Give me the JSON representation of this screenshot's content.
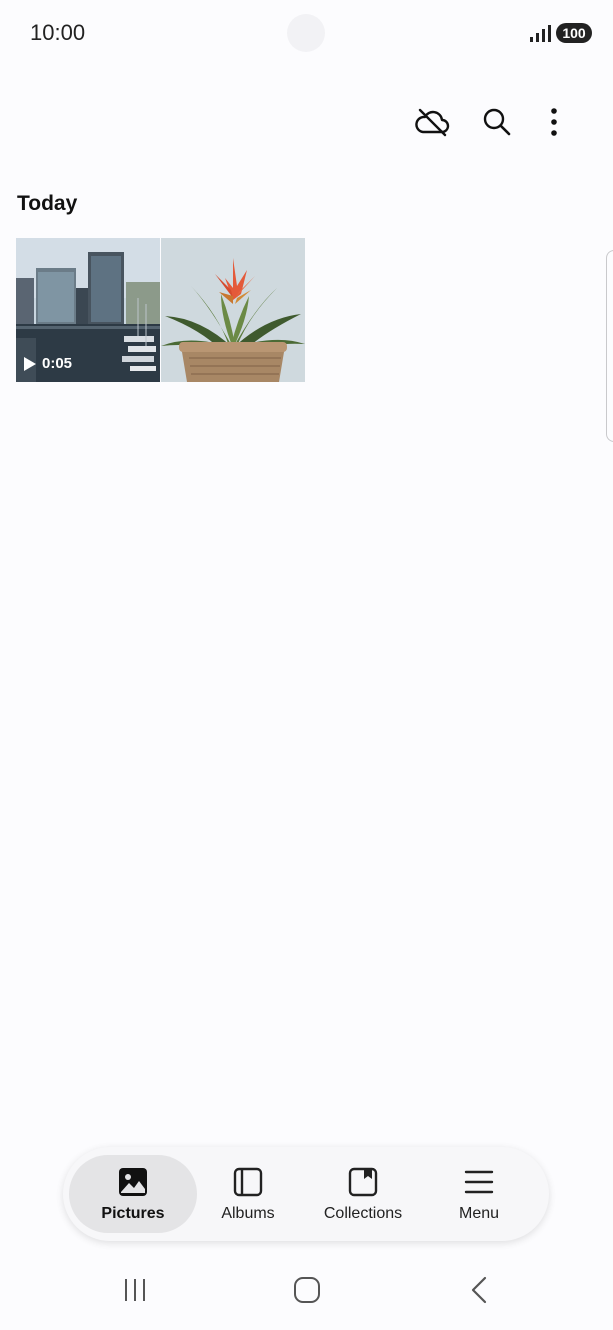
{
  "status_bar": {
    "time": "10:00",
    "battery": "100"
  },
  "toolbar": {
    "icons": [
      "cloud-off-icon",
      "search-icon",
      "more-vertical-icon"
    ]
  },
  "gallery": {
    "section_title": "Today",
    "items": [
      {
        "type": "video",
        "duration": "0:05",
        "subject": "harbor buildings"
      },
      {
        "type": "image",
        "subject": "potted bromeliad"
      }
    ]
  },
  "bottom_nav": {
    "items": [
      {
        "label": "Pictures",
        "icon": "pictures-icon",
        "active": true
      },
      {
        "label": "Albums",
        "icon": "albums-icon",
        "active": false
      },
      {
        "label": "Collections",
        "icon": "collections-icon",
        "active": false
      },
      {
        "label": "Menu",
        "icon": "menu-icon",
        "active": false
      }
    ]
  },
  "colors": {
    "background": "#fcfcfe",
    "active_tab": "#e4e4e6",
    "accent_plant": "#e45a3a"
  }
}
